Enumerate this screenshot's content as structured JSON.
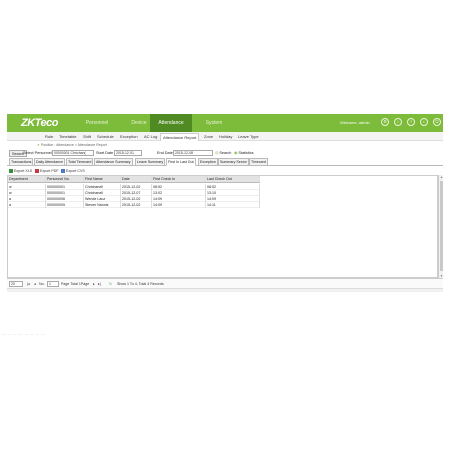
{
  "app": {
    "logo": "ZKTeco",
    "welcome": "Welcome, admin"
  },
  "nav": [
    {
      "label": "Personnel",
      "active": false
    },
    {
      "label": "Device",
      "active": false
    },
    {
      "label": "Attendance",
      "active": true
    },
    {
      "label": "System",
      "active": false
    }
  ],
  "subnav": [
    {
      "label": "Rule"
    },
    {
      "label": "Timetable"
    },
    {
      "label": "Shift"
    },
    {
      "label": "Schedule"
    },
    {
      "label": "Exception"
    },
    {
      "label": "AC Log"
    },
    {
      "label": "Attendance Report",
      "active": true
    },
    {
      "label": "Zone"
    },
    {
      "label": "Holiday"
    },
    {
      "label": "Leave Type"
    }
  ],
  "breadcrumb": "Position : Attendance > Attendance Report",
  "filters": {
    "search_label": "Search",
    "personnel_label": "Select Personnel",
    "personnel_value": "00000001 Chrichan(",
    "start_label": "Start Date",
    "start_value": "2015-12-01",
    "end_label": "End Date",
    "end_value": "2015-12-08",
    "search_button": "Search",
    "statistics_button": "Statistics"
  },
  "report_tabs": [
    {
      "label": "Transactions"
    },
    {
      "label": "Daily Attendance"
    },
    {
      "label": "Total Timecard"
    },
    {
      "label": "Attendance Summary"
    },
    {
      "label": "Leave Summary"
    },
    {
      "label": "First In Last Out",
      "active": true
    },
    {
      "label": "Exception"
    },
    {
      "label": "Summary Sector"
    },
    {
      "label": "Timecard"
    }
  ],
  "exports": [
    {
      "label": "Export XLS"
    },
    {
      "label": "Export PDF"
    },
    {
      "label": "Export CVS"
    }
  ],
  "table": {
    "columns": [
      "Department",
      "Personnel No.",
      "First Name",
      "Date",
      "First Check In",
      "Last Check Out"
    ],
    "rows": [
      [
        "w",
        "000000001",
        "Chrichanell",
        "2015-12-02",
        "08:52",
        "08:52"
      ],
      [
        "w",
        "000000001",
        "Chrichanell",
        "2015-12-07",
        "13:02",
        "13:10"
      ],
      [
        "a",
        "000000006",
        "Wende Lauz",
        "2015-12-02",
        "14:09",
        "14:09"
      ],
      [
        "a",
        "000000005",
        "Steven Nannis",
        "2015-12-02",
        "14:09",
        "14:11"
      ]
    ]
  },
  "pager": {
    "page_size": "20",
    "no_label": "No.",
    "page_input": "1",
    "page_total": "Page Total 1Page",
    "summary": "Show 1 To 4, Total 4 Records"
  },
  "colors": {
    "brand": "#7dbb3a",
    "brand_dark": "#4f8b22"
  }
}
